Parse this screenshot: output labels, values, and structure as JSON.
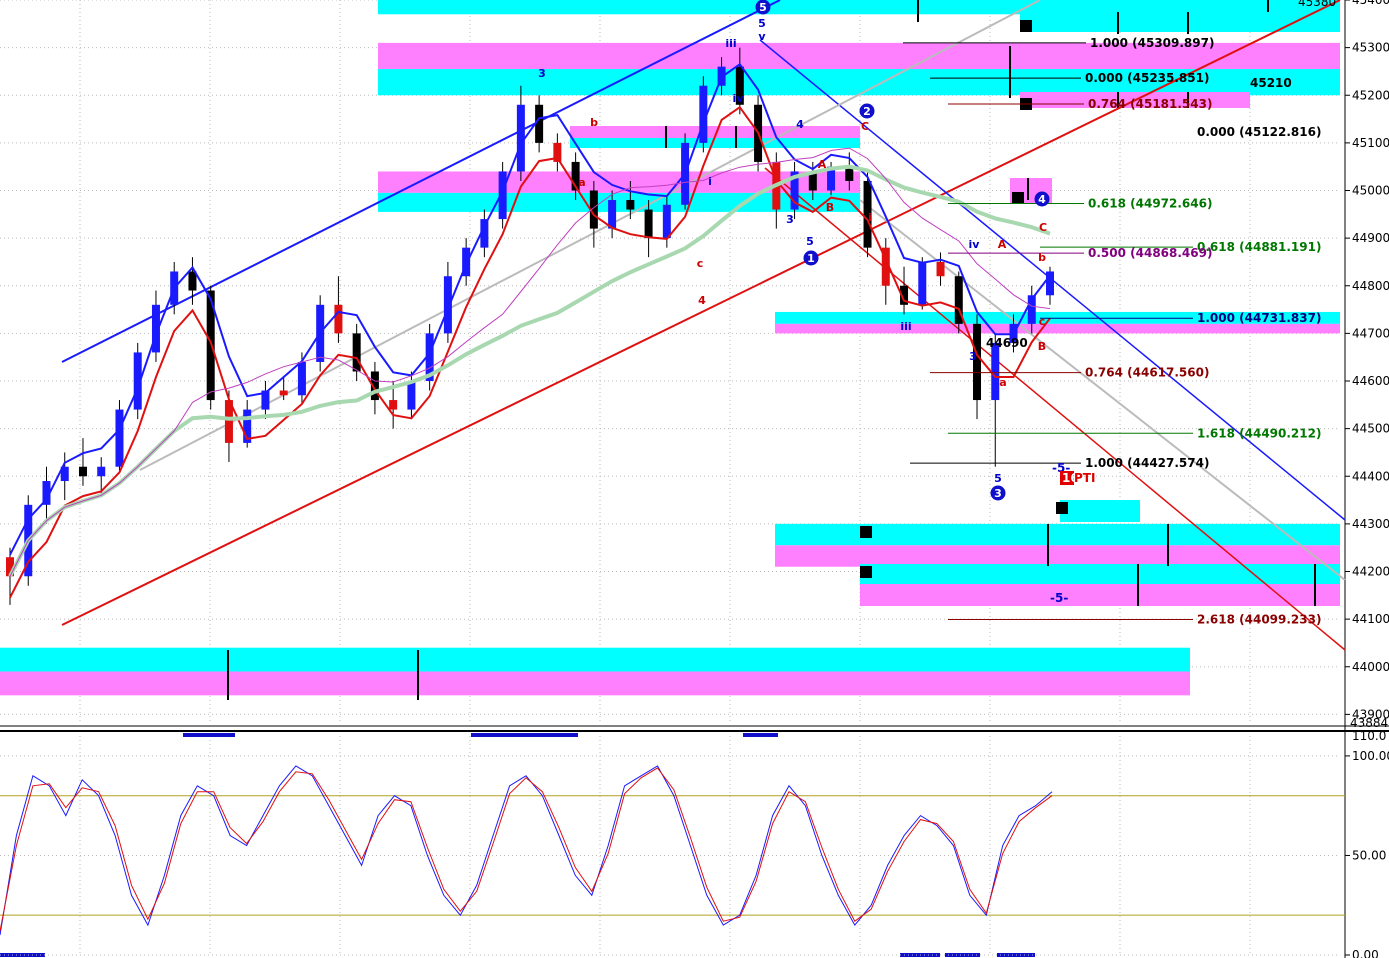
{
  "chart_data": [
    {
      "type": "candlestick",
      "panel": "price",
      "ylim": [
        43884,
        45400
      ],
      "y_ticks": [
        "45400",
        "45300",
        "45200",
        "45100",
        "45000",
        "44900",
        "44800",
        "44700",
        "44600",
        "44500",
        "44400",
        "44300",
        "44200",
        "44100",
        "44000",
        "43900"
      ],
      "y_edge_labels": [
        "45380",
        "43884"
      ],
      "grid": true,
      "candles": [
        [
          44230,
          44250,
          44130,
          44190
        ],
        [
          44190,
          44360,
          44170,
          44340
        ],
        [
          44340,
          44420,
          44300,
          44390
        ],
        [
          44390,
          44450,
          44350,
          44420
        ],
        [
          44420,
          44480,
          44380,
          44400
        ],
        [
          44400,
          44440,
          44360,
          44420
        ],
        [
          44420,
          44560,
          44410,
          44540
        ],
        [
          44540,
          44680,
          44520,
          44660
        ],
        [
          44660,
          44790,
          44640,
          44760
        ],
        [
          44760,
          44850,
          44740,
          44830
        ],
        [
          44830,
          44860,
          44760,
          44790
        ],
        [
          44790,
          44800,
          44540,
          44560
        ],
        [
          44560,
          44580,
          44430,
          44470
        ],
        [
          44470,
          44560,
          44460,
          44540
        ],
        [
          44540,
          44600,
          44520,
          44580
        ],
        [
          44580,
          44610,
          44560,
          44570
        ],
        [
          44570,
          44660,
          44550,
          44640
        ],
        [
          44640,
          44780,
          44620,
          44760
        ],
        [
          44760,
          44820,
          44680,
          44700
        ],
        [
          44700,
          44720,
          44600,
          44620
        ],
        [
          44620,
          44640,
          44530,
          44560
        ],
        [
          44560,
          44600,
          44500,
          44540
        ],
        [
          44540,
          44620,
          44520,
          44600
        ],
        [
          44600,
          44720,
          44580,
          44700
        ],
        [
          44700,
          44850,
          44680,
          44820
        ],
        [
          44820,
          44900,
          44800,
          44880
        ],
        [
          44880,
          44960,
          44860,
          44940
        ],
        [
          44940,
          45060,
          44920,
          45040
        ],
        [
          45040,
          45220,
          45020,
          45180
        ],
        [
          45180,
          45200,
          45080,
          45100
        ],
        [
          45100,
          45120,
          45040,
          45060
        ],
        [
          45060,
          45080,
          44980,
          45000
        ],
        [
          45000,
          45020,
          44880,
          44920
        ],
        [
          44920,
          45000,
          44900,
          44980
        ],
        [
          44980,
          45020,
          44940,
          44960
        ],
        [
          44960,
          44980,
          44860,
          44900
        ],
        [
          44900,
          44990,
          44880,
          44970
        ],
        [
          44970,
          45120,
          44960,
          45100
        ],
        [
          45100,
          45240,
          45080,
          45220
        ],
        [
          45220,
          45280,
          45200,
          45260
        ],
        [
          45260,
          45300,
          45160,
          45180
        ],
        [
          45180,
          45200,
          45040,
          45060
        ],
        [
          45060,
          45080,
          44920,
          44960
        ],
        [
          44960,
          45060,
          44940,
          45040
        ],
        [
          45040,
          45060,
          44980,
          45000
        ],
        [
          45000,
          45060,
          44990,
          45050
        ],
        [
          45050,
          45080,
          45000,
          45020
        ],
        [
          45020,
          45040,
          44860,
          44880
        ],
        [
          44880,
          44900,
          44760,
          44800
        ],
        [
          44800,
          44840,
          44740,
          44760
        ],
        [
          44760,
          44860,
          44750,
          44850
        ],
        [
          44850,
          44870,
          44800,
          44820
        ],
        [
          44820,
          44830,
          44700,
          44720
        ],
        [
          44720,
          44740,
          44520,
          44560
        ],
        [
          44560,
          44700,
          44420,
          44680
        ],
        [
          44680,
          44740,
          44660,
          44720
        ],
        [
          44720,
          44800,
          44700,
          44780
        ],
        [
          44780,
          44840,
          44760,
          44830
        ]
      ],
      "moving_averages": [
        {
          "name": "Band upper",
          "color": "#1a1aff"
        },
        {
          "name": "Band lower",
          "color": "#e01010"
        },
        {
          "name": "Long MA",
          "color": "#a8d8b0"
        },
        {
          "name": "MA",
          "color": "#c040c0"
        }
      ],
      "zones": [
        {
          "y1": 45400,
          "y2": 45370,
          "color": "#00ffff"
        },
        {
          "y1": 45310,
          "y2": 45255,
          "color": "#ff80ff"
        },
        {
          "y1": 45255,
          "y2": 45200,
          "color": "#00ffff"
        },
        {
          "y1": 45040,
          "y2": 44995,
          "color": "#ff80ff"
        },
        {
          "y1": 44995,
          "y2": 44955,
          "color": "#00ffff"
        },
        {
          "y1": 44745,
          "y2": 44720,
          "color": "#00ffff"
        },
        {
          "y1": 44720,
          "y2": 44700,
          "color": "#ff80ff"
        },
        {
          "y1": 44300,
          "y2": 44255,
          "color": "#00ffff"
        },
        {
          "y1": 44255,
          "y2": 44210,
          "color": "#ff80ff"
        },
        {
          "y1": 44040,
          "y2": 43990,
          "color": "#00ffff"
        },
        {
          "y1": 43990,
          "y2": 43940,
          "color": "#ff80ff"
        }
      ],
      "fib_levels": [
        {
          "label": "1.000 (45309.897)",
          "value": 45309.897,
          "color": "#000000"
        },
        {
          "label": "0.000 (45235.851)",
          "value": 45235.851,
          "color": "#000000"
        },
        {
          "label": "0.000 (45122.816)",
          "value": 45122.816,
          "color": "#000000"
        },
        {
          "label": "0.764 (45181.543)",
          "value": 45181.543,
          "color": "#8b0000"
        },
        {
          "label": "0.618 (44972.646)",
          "value": 44972.646,
          "color": "#007700"
        },
        {
          "label": "0.618 (44881.191)",
          "value": 44881.191,
          "color": "#007700"
        },
        {
          "label": "0.500 (44868.469)",
          "value": 44868.469,
          "color": "#800080"
        },
        {
          "label": "1.000 (44731.837)",
          "value": 44731.837,
          "color": "#000080"
        },
        {
          "label": "0.764 (44617.560)",
          "value": 44617.56,
          "color": "#8b0000"
        },
        {
          "label": "1.618 (44490.212)",
          "value": 44490.212,
          "color": "#007700"
        },
        {
          "label": "1.000 (44427.574)",
          "value": 44427.574,
          "color": "#000000"
        },
        {
          "label": "2.618 (44099.233)",
          "value": 44099.233,
          "color": "#8b0000"
        }
      ],
      "annotations": [
        {
          "text": "45210",
          "value": 45210,
          "color": "#000000"
        },
        {
          "text": "44690",
          "value": 44690,
          "color": "#000000"
        },
        {
          "text": "-5-",
          "value": 44150,
          "color": "#0000cc"
        },
        {
          "text": "-5-",
          "value": 44420,
          "color": "#0000cc"
        },
        {
          "text": "16",
          "value": 44400,
          "color": "#ffffff"
        },
        {
          "text": "PTI",
          "value": 44400,
          "color": "#e00000"
        }
      ],
      "wave_labels": [
        {
          "text": "3",
          "color": "#0000cc"
        },
        {
          "text": "5",
          "color": "#0000cc"
        },
        {
          "text": "iii",
          "color": "#0000cc"
        },
        {
          "text": "iv",
          "color": "#0000cc"
        },
        {
          "text": "v",
          "color": "#0000cc"
        },
        {
          "text": "b",
          "color": "#cc0000"
        },
        {
          "text": "a",
          "color": "#cc0000"
        },
        {
          "text": "c",
          "color": "#cc0000"
        },
        {
          "text": "4",
          "color": "#0000cc"
        },
        {
          "text": "3",
          "color": "#0000cc"
        },
        {
          "text": "5",
          "color": "#0000cc"
        },
        {
          "text": "A",
          "color": "#cc0000"
        },
        {
          "text": "B",
          "color": "#cc0000"
        },
        {
          "text": "C",
          "color": "#cc0000"
        },
        {
          "text": "i",
          "color": "#cc0000"
        },
        {
          "text": "iii",
          "color": "#0000cc"
        },
        {
          "text": "iv",
          "color": "#0000cc"
        },
        {
          "text": "3",
          "color": "#0000cc"
        },
        {
          "text": "5",
          "color": "#0000cc"
        },
        {
          "text": "A",
          "color": "#cc0000"
        },
        {
          "text": "B",
          "color": "#cc0000"
        },
        {
          "text": "C",
          "color": "#cc0000"
        },
        {
          "text": "a",
          "color": "#cc0000"
        },
        {
          "text": "b",
          "color": "#cc0000"
        },
        {
          "text": "c",
          "color": "#cc0000"
        },
        {
          "text": "i",
          "color": "#0000cc"
        },
        {
          "text": "4",
          "color": "#cc0000"
        }
      ],
      "circled_labels": [
        "5",
        "2",
        "1",
        "4",
        "3"
      ]
    },
    {
      "type": "line",
      "panel": "oscillator",
      "ylim": [
        0,
        110
      ],
      "y_ticks": [
        "100.00",
        "50.00",
        "0.00"
      ],
      "y_edge_labels": [
        "110.0"
      ],
      "reference_lines": [
        80,
        20
      ],
      "series": [
        {
          "color": "#1a1aff",
          "values": [
            10,
            60,
            90,
            85,
            70,
            88,
            80,
            60,
            30,
            15,
            40,
            70,
            85,
            80,
            60,
            55,
            70,
            85,
            95,
            90,
            75,
            60,
            45,
            70,
            80,
            75,
            50,
            30,
            20,
            35,
            60,
            85,
            90,
            80,
            60,
            40,
            30,
            55,
            85,
            90,
            95,
            80,
            55,
            30,
            15,
            20,
            40,
            70,
            85,
            75,
            50,
            30,
            15,
            25,
            45,
            60,
            70,
            65,
            55,
            30,
            20,
            55,
            70,
            75,
            82
          ]
        },
        {
          "color": "#e01010",
          "values": [
            12,
            55,
            85,
            86,
            74,
            84,
            82,
            65,
            35,
            18,
            36,
            66,
            82,
            82,
            64,
            56,
            67,
            82,
            92,
            91,
            78,
            63,
            48,
            66,
            78,
            77,
            54,
            33,
            22,
            32,
            56,
            81,
            89,
            82,
            64,
            44,
            32,
            51,
            81,
            89,
            94,
            83,
            59,
            34,
            17,
            19,
            37,
            66,
            82,
            77,
            54,
            33,
            17,
            23,
            42,
            57,
            68,
            66,
            57,
            33,
            21,
            51,
            67,
            74,
            80
          ]
        }
      ]
    }
  ]
}
